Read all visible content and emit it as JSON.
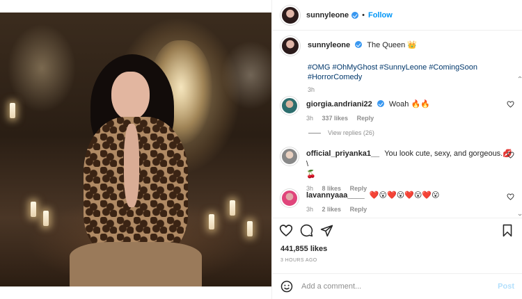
{
  "post": {
    "username": "sunnyleone",
    "follow_separator": "•",
    "follow_label": "Follow",
    "caption_text": "The Queen 👑",
    "hashtags_line1": "#OMG #OhMyGhost #SunnyLeone #ComingSoon",
    "hashtags_line2": "#HorrorComedy",
    "caption_age": "3h",
    "likes": "441,855 likes",
    "timestamp": "3 HOURS AGO"
  },
  "comments": [
    {
      "username": "giorgia.andriani22",
      "verified": true,
      "text": "Woah 🔥🔥",
      "age": "3h",
      "likes": "337 likes",
      "reply_label": "Reply"
    },
    {
      "username": "official_priyanka1__",
      "verified": false,
      "text": "You look cute, sexy, and gorgeous.💋 \\",
      "text2": "🍒",
      "age": "3h",
      "likes": "8 likes",
      "reply_label": "Reply"
    },
    {
      "username": "lavannyaaa____",
      "verified": false,
      "text": "❤️😮❤️😮❤️😮❤️😮",
      "age": "3h",
      "likes": "2 likes",
      "reply_label": "Reply"
    }
  ],
  "view_replies_label": "View replies (26)",
  "add_comment": {
    "placeholder": "Add a comment...",
    "post_label": "Post"
  },
  "icons": [
    "heart-icon",
    "comment-icon",
    "share-icon",
    "bookmark-icon",
    "emoji-icon",
    "verified-badge-icon"
  ],
  "colors": {
    "link": "#00376b",
    "follow": "#0095f6",
    "verified": "#3897f0",
    "muted": "#8e8e8e",
    "post_disabled": "#b2dffc"
  }
}
